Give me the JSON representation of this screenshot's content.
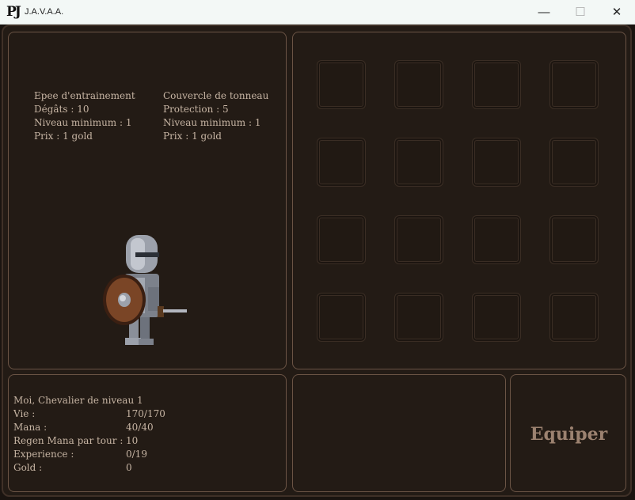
{
  "window": {
    "logo": "PJ",
    "title": "J.A.V.A.A.",
    "minimize": "—",
    "maximize": "☐",
    "close": "✕"
  },
  "weapon": {
    "name": "Epee d'entrainement",
    "stat": "Dégâts : 10",
    "level": "Niveau minimum : 1",
    "price": "Prix : 1 gold"
  },
  "shield": {
    "name": "Couvercle de tonneau",
    "stat": "Protection : 5",
    "level": "Niveau minimum : 1",
    "price": "Prix : 1 gold"
  },
  "character": {
    "sprite": "armored-knight-sprite"
  },
  "inventory": {
    "rows": 4,
    "cols": 4
  },
  "stats": {
    "header": "Moi, Chevalier de niveau 1",
    "rows": [
      {
        "label": "Vie :",
        "value": "170/170"
      },
      {
        "label": "Mana :",
        "value": "40/40"
      },
      {
        "label": "Regen Mana par tour :",
        "value": "10"
      },
      {
        "label": "Experience :",
        "value": "0/19"
      },
      {
        "label": "Gold :",
        "value": "0"
      }
    ]
  },
  "actions": {
    "equip_label": "Equiper"
  },
  "colors": {
    "background": "#231b15",
    "border": "#6b5445",
    "text": "#c6b4a3",
    "button_text": "#9c8270"
  }
}
